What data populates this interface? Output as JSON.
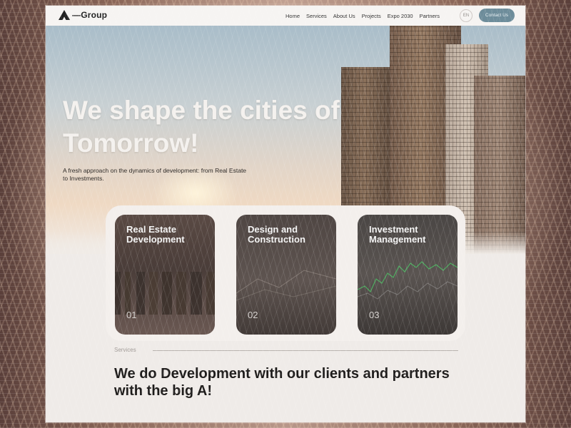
{
  "brand": {
    "name": "—Group"
  },
  "nav": {
    "items": [
      "Home",
      "Services",
      "About Us",
      "Projects",
      "Expo 2030",
      "Partners"
    ]
  },
  "language": {
    "label": "EN"
  },
  "cta": {
    "label": "Contact Us"
  },
  "hero": {
    "headline": "We shape the cities of Tomorrow!",
    "subline": "A fresh approach on the dynamics of development: from Real Estate to Investments."
  },
  "cards": [
    {
      "title": "Real Estate Development",
      "number": "01"
    },
    {
      "title": "Design and Construction",
      "number": "02"
    },
    {
      "title": "Investment Management",
      "number": "03"
    }
  ],
  "services": {
    "label": "Services",
    "tagline": "We do Development with our clients and partners with the big A!"
  },
  "colors": {
    "cta": "#6d8c9a",
    "page": "#efebe8",
    "text": "#1d1b1a"
  }
}
